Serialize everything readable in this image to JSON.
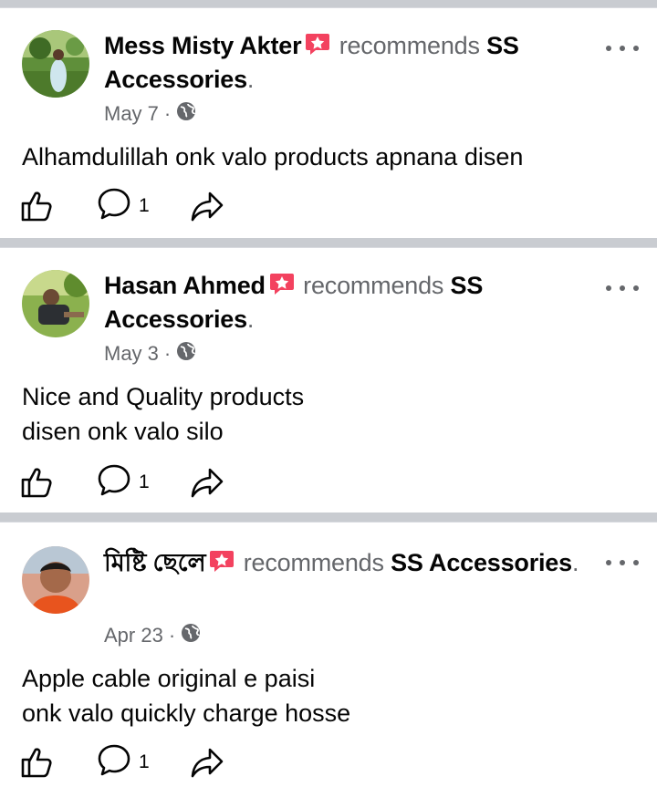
{
  "posts": [
    {
      "name": "Mess Misty Akter",
      "recommends": "recommends",
      "page": "SS Accessories",
      "period": ".",
      "date": "May 7",
      "separator": "·",
      "text": [
        "Alhamdulillah onk valo products apnana disen"
      ],
      "comment_count": "1"
    },
    {
      "name": "Hasan Ahmed",
      "recommends": "recommends",
      "page": "SS Accessories",
      "period": ".",
      "date": "May 3",
      "separator": "·",
      "text": [
        "Nice and Quality products",
        "disen onk valo silo"
      ],
      "comment_count": "1"
    },
    {
      "name": "মিষ্টি ছেলে",
      "recommends": "recommends",
      "page": "SS Accessories",
      "period": ".",
      "date": "Apr 23",
      "separator": "·",
      "text": [
        "Apple cable original e paisi",
        "onk valo quickly charge hosse"
      ],
      "comment_count": "1"
    }
  ],
  "colors": {
    "badge": "#f3425f",
    "secondary_text": "#65676b",
    "divider": "#c9ccd1"
  },
  "icons": [
    "recommend-badge-icon",
    "globe-icon",
    "like-icon",
    "comment-icon",
    "share-icon",
    "more-options-icon"
  ]
}
